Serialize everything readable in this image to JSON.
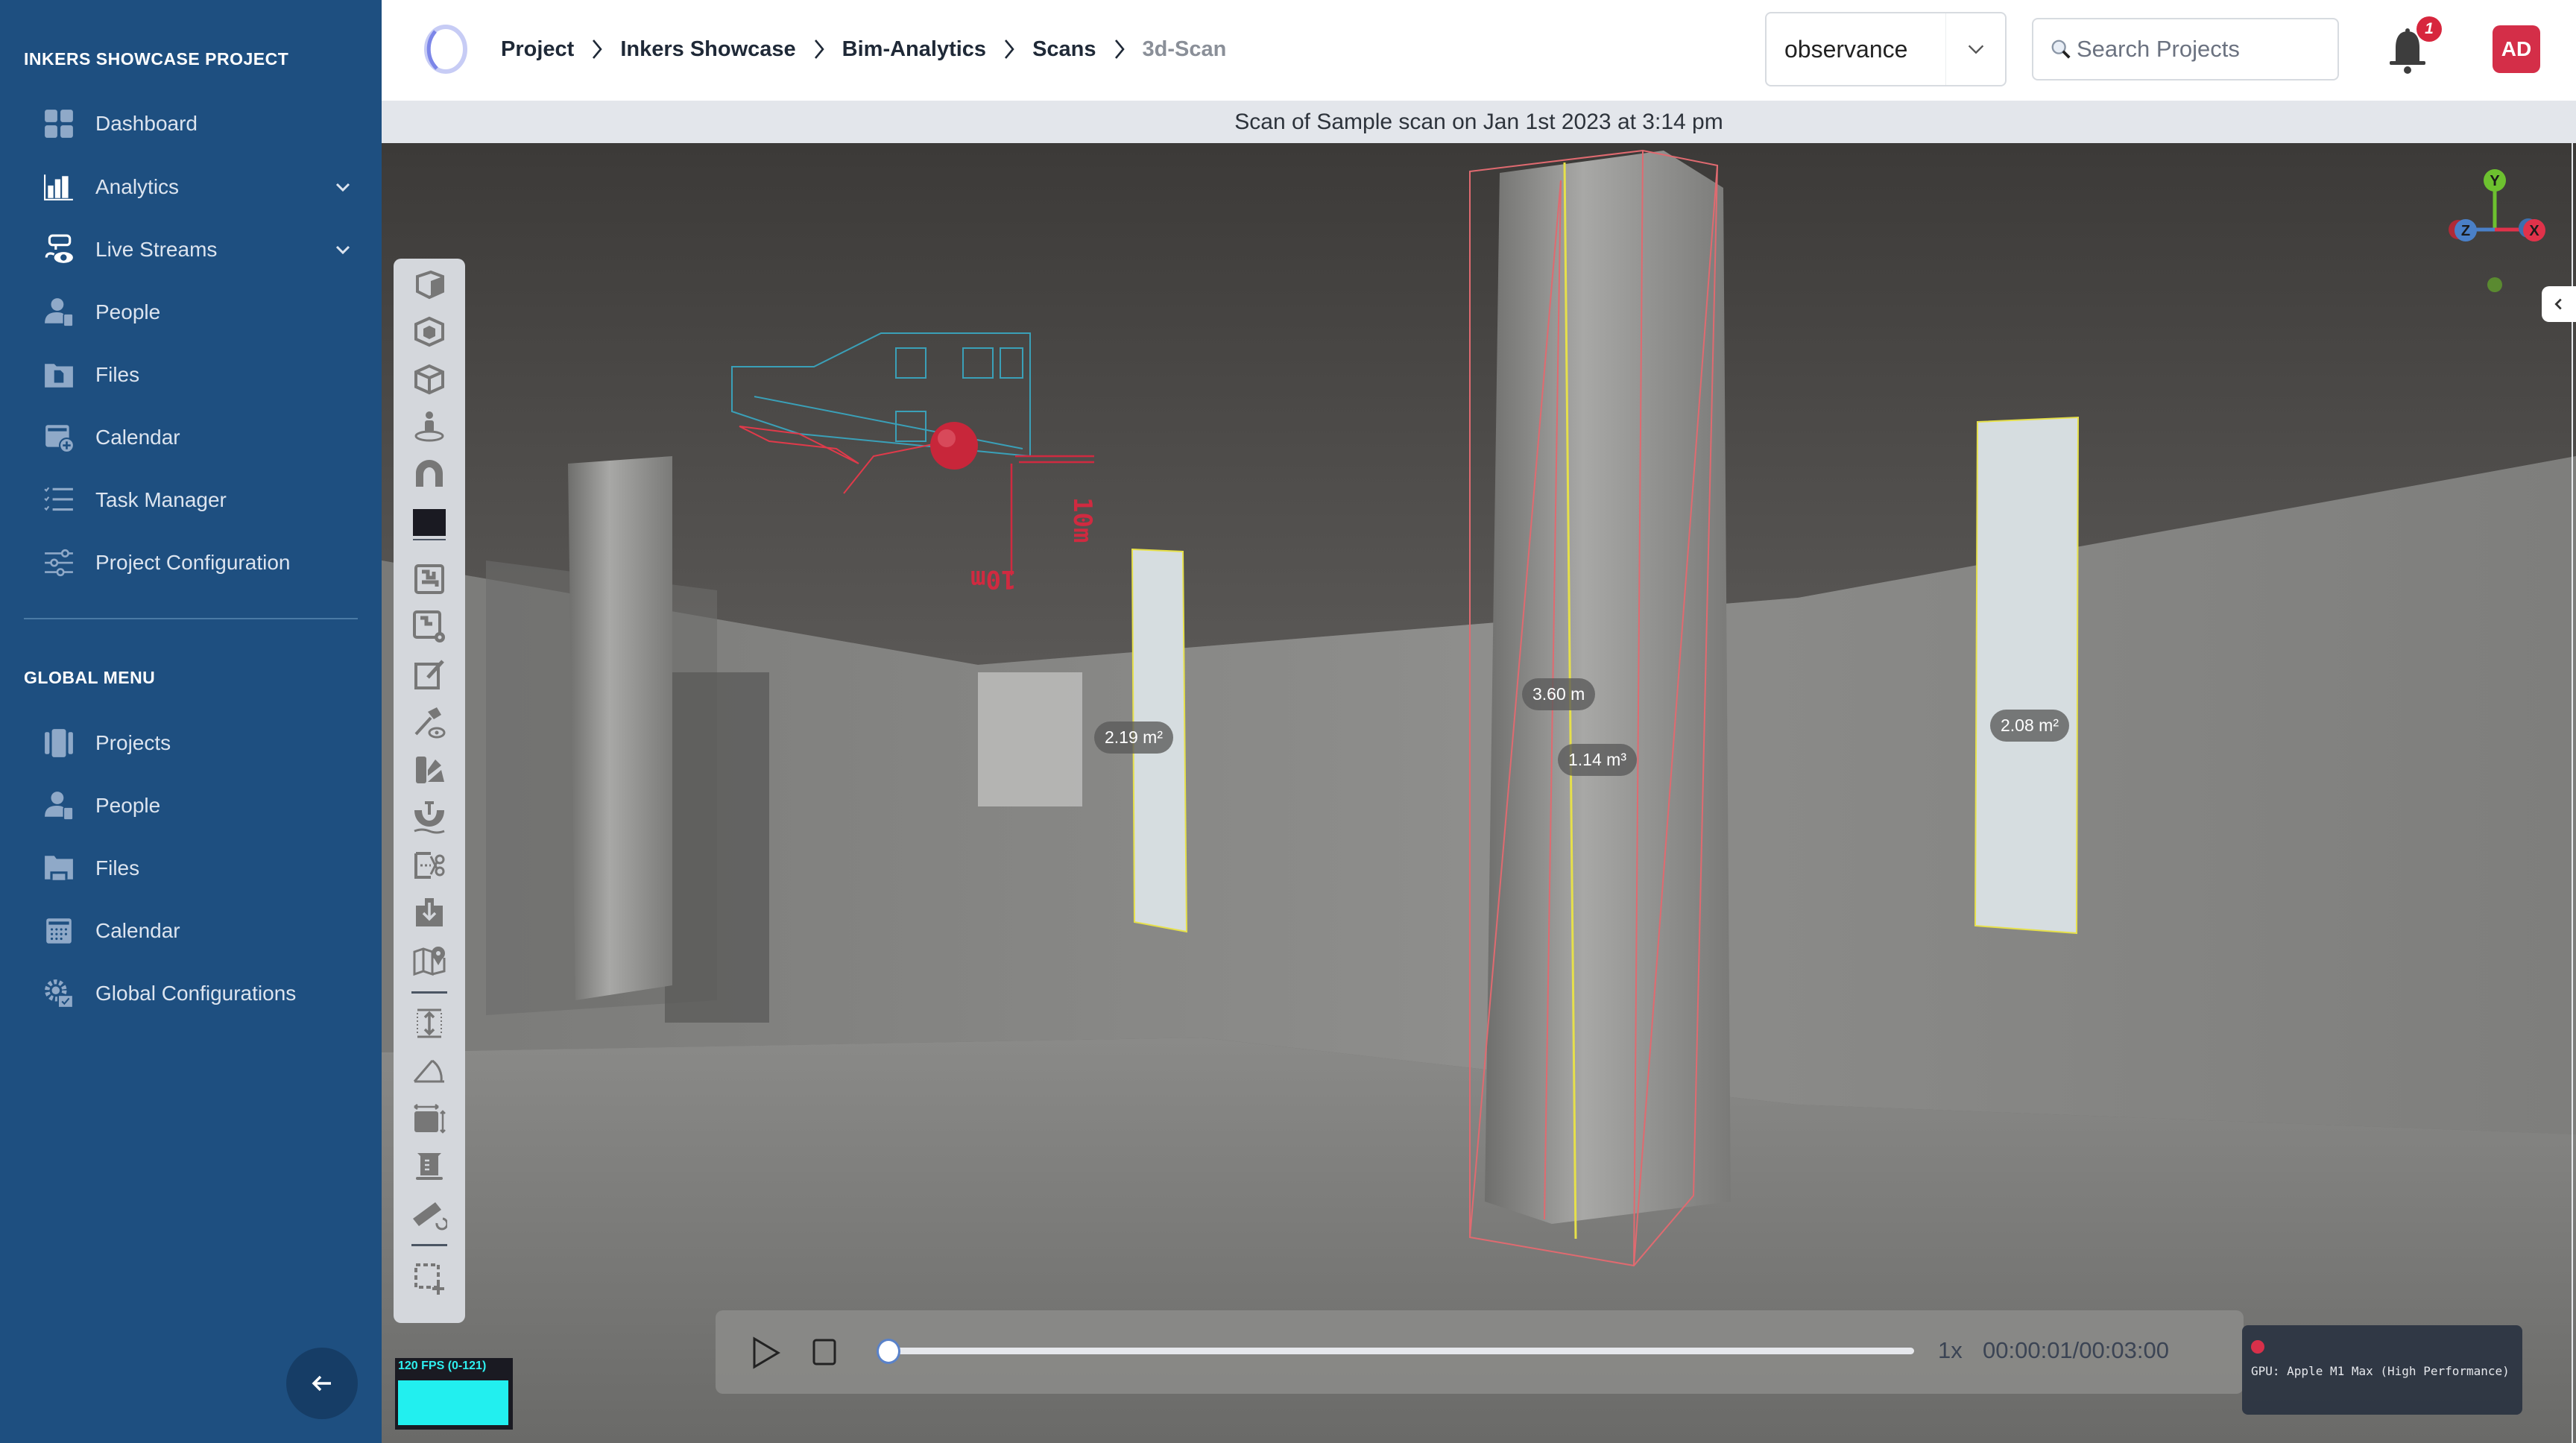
{
  "sidebar": {
    "project_title": "INKERS SHOWCASE PROJECT",
    "project_items": [
      {
        "label": "Dashboard",
        "icon": "dashboard-icon",
        "expandable": false
      },
      {
        "label": "Analytics",
        "icon": "bar-chart-icon",
        "expandable": true
      },
      {
        "label": "Live Streams",
        "icon": "cctv-camera-icon",
        "expandable": true
      },
      {
        "label": "People",
        "icon": "person-document-icon",
        "expandable": false
      },
      {
        "label": "Files",
        "icon": "folder-file-icon",
        "expandable": false
      },
      {
        "label": "Calendar",
        "icon": "calendar-add-icon",
        "expandable": false
      },
      {
        "label": "Task Manager",
        "icon": "checklist-icon",
        "expandable": false
      },
      {
        "label": "Project Configuration",
        "icon": "sliders-icon",
        "expandable": false
      }
    ],
    "global_title": "GLOBAL MENU",
    "global_items": [
      {
        "label": "Projects",
        "icon": "projects-icon"
      },
      {
        "label": "People",
        "icon": "person-document-icon"
      },
      {
        "label": "Files",
        "icon": "folder-icon"
      },
      {
        "label": "Calendar",
        "icon": "calendar-icon"
      },
      {
        "label": "Global Configurations",
        "icon": "gear-config-icon"
      }
    ],
    "collapse_icon": "arrow-left-icon"
  },
  "header": {
    "breadcrumb": [
      "Project",
      "Inkers Showcase",
      "Bim-Analytics",
      "Scans",
      "3d-Scan"
    ],
    "view_select": {
      "value": "observance"
    },
    "search": {
      "placeholder": "Search Projects",
      "value": ""
    },
    "notifications": {
      "count": "1"
    },
    "user_initials": "AD"
  },
  "scan": {
    "title": "Scan of Sample scan on Jan 1st 2023 at 3:14 pm"
  },
  "viewer": {
    "toolbar": [
      "cube-solid-icon",
      "cube-section-icon",
      "cube-outline-icon",
      "first-person-icon",
      "magnet-icon",
      "color-swatch-icon",
      "floorplan-icon",
      "floorplan-settings-icon",
      "edit-note-icon",
      "hammer-eye-icon",
      "paint-bucket-icon",
      "excavation-icon",
      "clip-cut-icon",
      "download-box-icon",
      "map-pin-icon",
      "height-measure-icon",
      "angle-measure-icon",
      "area-measure-icon",
      "volume-measure-icon",
      "ruler-rotate-icon",
      "select-add-icon"
    ],
    "measurements": [
      {
        "label": "2.19 m²",
        "kind": "area"
      },
      {
        "label": "3.60 m",
        "kind": "height"
      },
      {
        "label": "1.14 m³",
        "kind": "volume"
      },
      {
        "label": "2.08 m²",
        "kind": "area"
      }
    ],
    "scale_markers": [
      "10m",
      "10m"
    ],
    "gizmo": {
      "x": "X",
      "y": "Y",
      "z": "Z"
    },
    "playback": {
      "speed": "1x",
      "time": "00:00:01/00:03:00",
      "progress": 0.0056
    },
    "fps": {
      "label": "120 FPS (0-121)"
    },
    "gpu": {
      "text": "GPU: Apple M1 Max (High Performance)"
    }
  },
  "colors": {
    "sidebar_bg": "#1e4f80",
    "accent_red": "#d42e48",
    "fps_cyan": "#22efef",
    "axis_x": "#e0324a",
    "axis_y": "#6dc12f",
    "axis_z": "#4a80c8"
  }
}
